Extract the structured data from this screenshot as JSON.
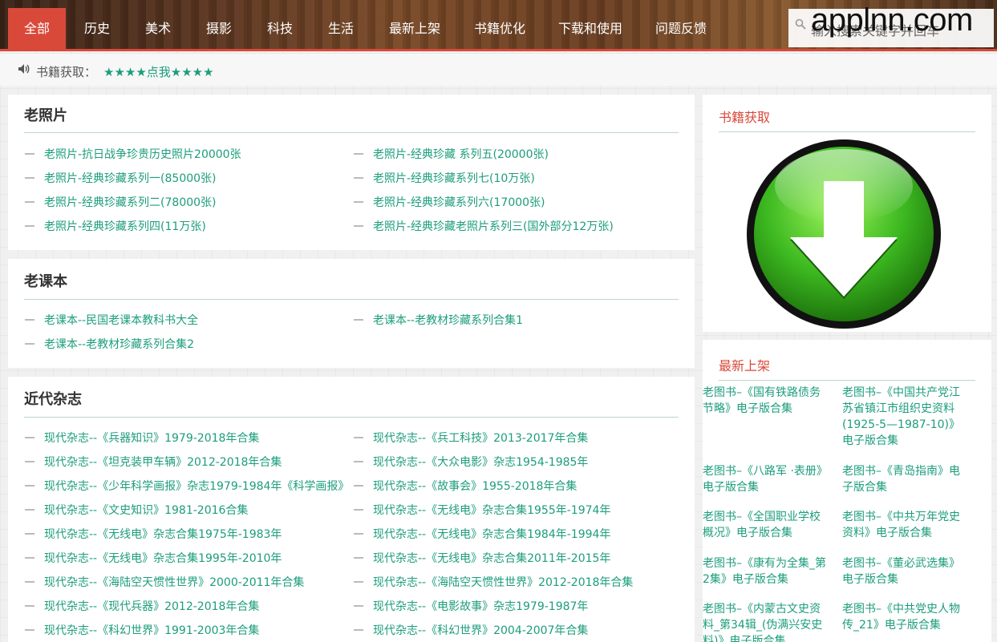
{
  "nav": {
    "items": [
      "全部",
      "历史",
      "美术",
      "摄影",
      "科技",
      "生活",
      "最新上架",
      "书籍优化",
      "下载和使用",
      "问题反馈"
    ],
    "search_placeholder": "输入搜索关键字并回车",
    "watermark": "applnn.com"
  },
  "notice": {
    "label": "书籍获取：",
    "link": "★★★★点我★★★★"
  },
  "sections": [
    {
      "title": "老照片",
      "left": [
        "老照片-抗日战争珍贵历史照片20000张",
        "老照片-经典珍藏系列一(85000张)",
        "老照片-经典珍藏系列二(78000张)",
        "老照片-经典珍藏系列四(11万张)"
      ],
      "right": [
        "老照片-经典珍藏 系列五(20000张)",
        "老照片-经典珍藏系列七(10万张)",
        "老照片-经典珍藏系列六(17000张)",
        "老照片-经典珍藏老照片系列三(国外部分12万张)"
      ]
    },
    {
      "title": "老课本",
      "left": [
        "老课本--民国老课本教科书大全",
        "老课本--老教材珍藏系列合集2"
      ],
      "right": [
        "老课本--老教材珍藏系列合集1"
      ]
    },
    {
      "title": "近代杂志",
      "left": [
        "现代杂志--《兵器知识》1979-2018年合集",
        "现代杂志--《坦克装甲车辆》2012-2018年合集",
        "现代杂志--《少年科学画报》杂志1979-1984年《科学画报》",
        "现代杂志--《文史知识》1981-2016合集",
        "现代杂志--《无线电》杂志合集1975年-1983年",
        "现代杂志--《无线电》杂志合集1995年-2010年",
        "现代杂志--《海陆空天惯性世界》2000-2011年合集",
        "现代杂志--《现代兵器》2012-2018年合集",
        "现代杂志--《科幻世界》1991-2003年合集"
      ],
      "right": [
        "现代杂志--《兵工科技》2013-2017年合集",
        "现代杂志--《大众电影》杂志1954-1985年",
        "现代杂志--《故事会》1955-2018年合集",
        "现代杂志--《无线电》杂志合集1955年-1974年",
        "现代杂志--《无线电》杂志合集1984年-1994年",
        "现代杂志--《无线电》杂志合集2011年-2015年",
        "现代杂志--《海陆空天惯性世界》2012-2018年合集",
        "现代杂志--《电影故事》杂志1979-1987年",
        "现代杂志--《科幻世界》2004-2007年合集"
      ]
    }
  ],
  "sidebar": {
    "get_title": "书籍获取",
    "new_title": "最新上架",
    "new_items": [
      "老图书–《国有铁路债务节略》电子版合集",
      "老图书–《中国共产党江苏省镇江市组织史资料(1925-5—1987-10)》电子版合集",
      "老图书–《八路军 ·表册》电子版合集",
      "老图书–《青岛指南》电子版合集",
      "老图书–《全国职业学校概况》电子版合集",
      "老图书–《中共万年党史资料》电子版合集",
      "老图书–《康有为全集_第2集》电子版合集",
      "老图书–《董必武选集》电子版合集",
      "老图书–《内蒙古文史资料_第34辑_(伪满兴安史料)》电子版合集",
      "老图书–《中共党史人物传_21》电子版合集"
    ]
  },
  "colors": {
    "accent": "#d9493a",
    "link": "#1c9d7c"
  }
}
